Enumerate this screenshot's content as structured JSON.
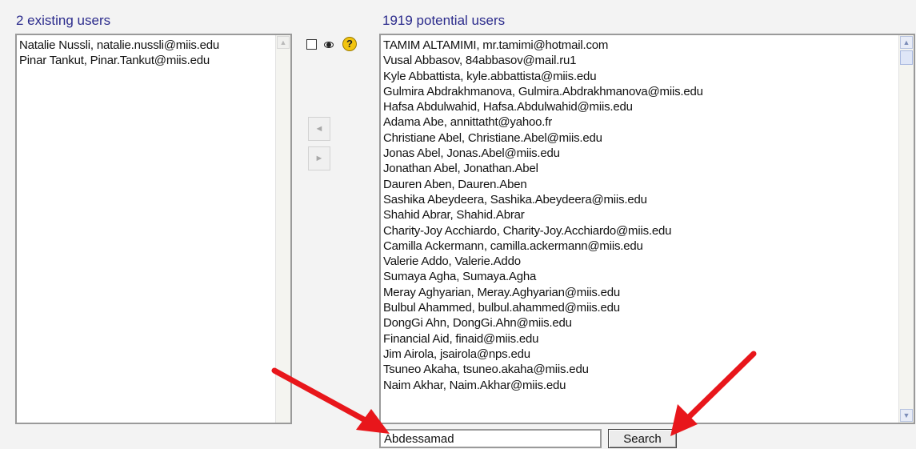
{
  "existing": {
    "heading": "2 existing users",
    "users": [
      "Natalie Nussli, natalie.nussli@miis.edu",
      "Pinar Tankut, Pinar.Tankut@miis.edu"
    ]
  },
  "controls": {
    "add_arrow": "◄",
    "remove_arrow": "►",
    "help_glyph": "?"
  },
  "potential": {
    "heading": "1919 potential users",
    "users": [
      "TAMIM ALTAMIMI, mr.tamimi@hotmail.com",
      "Vusal Abbasov, 84abbasov@mail.ru1",
      "Kyle Abbattista, kyle.abbattista@miis.edu",
      "Gulmira Abdrakhmanova, Gulmira.Abdrakhmanova@miis.edu",
      "Hafsa Abdulwahid, Hafsa.Abdulwahid@miis.edu",
      "Adama Abe, annittatht@yahoo.fr",
      "Christiane Abel, Christiane.Abel@miis.edu",
      "Jonas Abel, Jonas.Abel@miis.edu",
      "Jonathan Abel, Jonathan.Abel",
      "Dauren Aben, Dauren.Aben",
      "Sashika Abeydeera, Sashika.Abeydeera@miis.edu",
      "Shahid Abrar, Shahid.Abrar",
      "Charity-Joy Acchiardo, Charity-Joy.Acchiardo@miis.edu",
      "Camilla Ackermann, camilla.ackermann@miis.edu",
      "Valerie Addo, Valerie.Addo",
      "Sumaya Agha, Sumaya.Agha",
      "Meray Aghyarian, Meray.Aghyarian@miis.edu",
      "Bulbul Ahammed, bulbul.ahammed@miis.edu",
      "DongGi Ahn, DongGi.Ahn@miis.edu",
      "Financial Aid, finaid@miis.edu",
      "Jim Airola, jsairola@nps.edu",
      "Tsuneo Akaha, tsuneo.akaha@miis.edu",
      "Naim Akhar, Naim.Akhar@miis.edu"
    ]
  },
  "search": {
    "value": "Abdessamad",
    "button_label": "Search"
  },
  "colors": {
    "heading": "#2b2b8c",
    "arrow": "#e8161b"
  }
}
